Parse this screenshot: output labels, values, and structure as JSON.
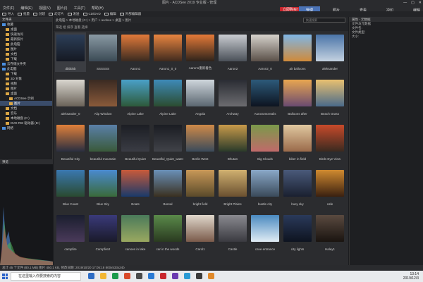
{
  "title_bar": {
    "title": "图片 - ACDSee 2019 专业版 - 管理",
    "controls": [
      "—",
      "▢",
      "✕"
    ]
  },
  "menu": [
    "文件(F)",
    "编辑(E)",
    "视图(V)",
    "图片(I)",
    "工具(T)",
    "帮助(H)"
  ],
  "toolbar": {
    "items": [
      "导入",
      "批量",
      "创建",
      "幻灯片",
      "发送",
      "CD/DVD",
      "编辑",
      "外部编辑器"
    ]
  },
  "buy_button": "立即购买！",
  "modes": [
    {
      "label": "管理",
      "active": true
    },
    {
      "label": "照片",
      "active": false
    },
    {
      "label": "查看",
      "active": false
    },
    {
      "label": "冲印",
      "active": false
    },
    {
      "label": "编辑",
      "active": false
    }
  ],
  "left_panel": {
    "header": "文件夹",
    "tree": [
      {
        "label": "收藏",
        "indent": 0,
        "selected": false
      },
      {
        "label": "桌面",
        "indent": 1,
        "selected": false
      },
      {
        "label": "快速访问",
        "indent": 1,
        "selected": false
      },
      {
        "label": "最新照片",
        "indent": 1,
        "selected": false
      },
      {
        "label": "此电脑",
        "indent": 1,
        "selected": false
      },
      {
        "label": "图片",
        "indent": 1,
        "selected": false
      },
      {
        "label": "文档",
        "indent": 1,
        "selected": false
      },
      {
        "label": "下载",
        "indent": 1,
        "selected": false
      },
      {
        "label": "云存储文件夹",
        "indent": 0,
        "selected": false
      },
      {
        "label": "此电脑",
        "indent": 0,
        "selected": false
      },
      {
        "label": "下载",
        "indent": 1,
        "selected": false
      },
      {
        "label": "3D 对象",
        "indent": 1,
        "selected": false
      },
      {
        "label": "视频",
        "indent": 1,
        "selected": false
      },
      {
        "label": "图片",
        "indent": 1,
        "selected": false
      },
      {
        "label": "桌面",
        "indent": 1,
        "selected": false
      },
      {
        "label": "ACDSee 示例",
        "indent": 2,
        "selected": false
      },
      {
        "label": "图片",
        "indent": 2,
        "selected": true
      },
      {
        "label": "文档",
        "indent": 1,
        "selected": false
      },
      {
        "label": "音乐",
        "indent": 1,
        "selected": false
      },
      {
        "label": "本地磁盘 (C:)",
        "indent": 1,
        "selected": false
      },
      {
        "label": "DVD RW 驱动器 (D:)",
        "indent": 1,
        "selected": false
      },
      {
        "label": "网络",
        "indent": 0,
        "selected": false
      }
    ],
    "histogram_header": "预览"
  },
  "center": {
    "path": "此电脑 > 本地磁盘 (C:) > 用户 > acdsee > 桌面 > 图片",
    "search_placeholder": "快速搜索",
    "subbar": "筛选  组  排序  查看  选择",
    "thumbnails": [
      {
        "label": "dbbbbb",
        "c1": "#2c3e58",
        "c2": "#151922"
      },
      {
        "label": "SSSSSS",
        "c1": "#8a9aa4",
        "c2": "#3b4a55"
      },
      {
        "label": "Aaron1",
        "c1": "#e27a3a",
        "c2": "#3a2a20"
      },
      {
        "label": "Aaron1_0_0",
        "c1": "#e98540",
        "c2": "#402a1e"
      },
      {
        "label": "Aaron1重新着色",
        "c1": "#e57a38",
        "c2": "#2e231b"
      },
      {
        "label": "Aaron2",
        "c1": "#c9ccd1",
        "c2": "#4a5058"
      },
      {
        "label": "Aaron2_0",
        "c1": "#d6d2cc",
        "c2": "#5a5048"
      },
      {
        "label": "air balloons",
        "c1": "#7fb6e6",
        "c2": "#d08a3a"
      },
      {
        "label": "aleksander",
        "c1": "#4a74a8",
        "c2": "#c4d2e0"
      },
      {
        "label": "aleksander_0",
        "c1": "#d9d6cf",
        "c2": "#6a6258"
      },
      {
        "label": "Alip Window",
        "c1": "#3a2a22",
        "c2": "#8a5a3a"
      },
      {
        "label": "Alpine Lake",
        "c1": "#4aa0c8",
        "c2": "#2d5a3a"
      },
      {
        "label": "Alpine Lake",
        "c1": "#3e8ab8",
        "c2": "#2b4c30"
      },
      {
        "label": "Angola",
        "c1": "#cfd6dc",
        "c2": "#5a6670"
      },
      {
        "label": "Archway",
        "c1": "#2a2c33",
        "c2": "#6c6c70"
      },
      {
        "label": "Aurora Borealis",
        "c1": "#2d5a7a",
        "c2": "#0d1420"
      },
      {
        "label": "Balloons after",
        "c1": "#e8a650",
        "c2": "#6a4a70"
      },
      {
        "label": "Beach Grass",
        "c1": "#e8c070",
        "c2": "#4a6a8a"
      },
      {
        "label": "Beautiful City",
        "c1": "#e0803a",
        "c2": "#2a2e40"
      },
      {
        "label": "beautiful mountain",
        "c1": "#5a80a8",
        "c2": "#3a5a3a"
      },
      {
        "label": "Beautiful Quiet",
        "c1": "#1c1e24",
        "c2": "#3a3c44"
      },
      {
        "label": "Beautiful_Quiet_waterm...",
        "c1": "#1a1c22",
        "c2": "#404248"
      },
      {
        "label": "Berlin West",
        "c1": "#cf8a48",
        "c2": "#3a4a5a"
      },
      {
        "label": "Bhutan",
        "c1": "#c89a4a",
        "c2": "#2a3a2a"
      },
      {
        "label": "Big Clouds",
        "c1": "#7a9a4a",
        "c2": "#c06a6a"
      },
      {
        "label": "biker in field",
        "c1": "#e0c8a0",
        "c2": "#9a6a4a"
      },
      {
        "label": "Birds Eye View",
        "c1": "#c84a2a",
        "c2": "#3a2a20"
      },
      {
        "label": "Blue Coast",
        "c1": "#3a78b0",
        "c2": "#2a4a30"
      },
      {
        "label": "Blue Sky",
        "c1": "#4a8ad0",
        "c2": "#3a6a3a"
      },
      {
        "label": "Boats",
        "c1": "#c85a3a",
        "c2": "#1a3a6a"
      },
      {
        "label": "Boreal",
        "c1": "#6a90b8",
        "c2": "#3a3020"
      },
      {
        "label": "bright field",
        "c1": "#c89858",
        "c2": "#5a4a2a"
      },
      {
        "label": "Bright Plains",
        "c1": "#d0b070",
        "c2": "#6a5030"
      },
      {
        "label": "bustle city",
        "c1": "#8aa8c8",
        "c2": "#3a4a5a"
      },
      {
        "label": "busy sky",
        "c1": "#4a5a7a",
        "c2": "#1a2030"
      },
      {
        "label": "cafe",
        "c1": "#d08a30",
        "c2": "#3a2010"
      },
      {
        "label": "campfire",
        "c1": "#1a1e2e",
        "c2": "#4a3a5a"
      },
      {
        "label": "Campfire2",
        "c1": "#3a3a7a",
        "c2": "#1a1a2a"
      },
      {
        "label": "canoes in lake",
        "c1": "#4a7a5a",
        "c2": "#9aa860"
      },
      {
        "label": "car in the woods",
        "c1": "#5a8a4a",
        "c2": "#2a3a20"
      },
      {
        "label": "Carol1",
        "c1": "#e0d8cc",
        "c2": "#7a5a4a"
      },
      {
        "label": "Castle",
        "c1": "#8a8a90",
        "c2": "#3a3a40"
      },
      {
        "label": "cave entrance",
        "c1": "#4a8ac0",
        "c2": "#e0ecf4"
      },
      {
        "label": "city lights",
        "c1": "#2a3a5a",
        "c2": "#0e1420"
      },
      {
        "label": "Haley1",
        "c1": "#5a4a40",
        "c2": "#1a1410"
      }
    ]
  },
  "right_panel": {
    "header": "属性 - 元数据",
    "props": [
      "文件与元数据",
      "文件名:",
      "文件类型:",
      "大小:"
    ]
  },
  "status_bar": "总计 45 个文件 (80.1 MB)   图片 450.1 KB, 修改日期: 2019/10/20 17:05:18   800x533x24b",
  "taskbar": {
    "search_text": "在这里输入你要搜索的内容",
    "apps": [
      "#2d6cc4",
      "#f2b632",
      "#1a9a4a",
      "#d84a2a",
      "#4a4a4a",
      "#2a7ad4",
      "#c8262d",
      "#6a3ab0",
      "#2a9ad4",
      "#3a3a3a",
      "#e0892a"
    ],
    "time": "13:14",
    "date": "2019/12/3"
  }
}
